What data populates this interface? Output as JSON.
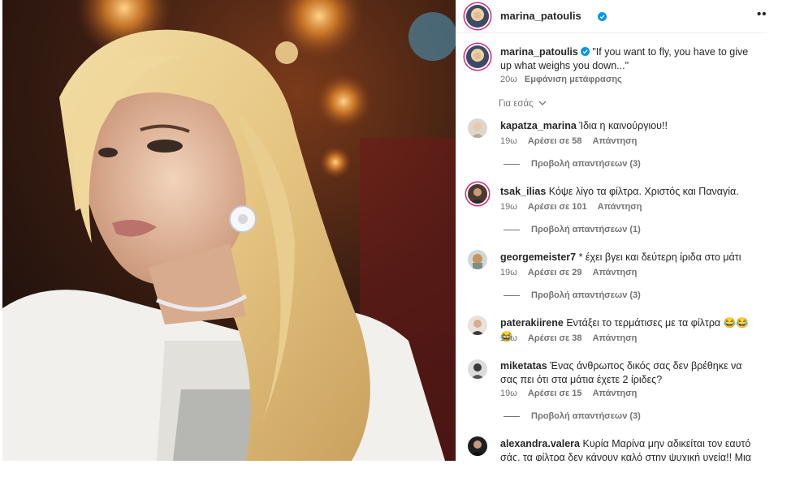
{
  "colors": {
    "accent": "#0095f6",
    "muted": "#737373",
    "text": "#262626"
  },
  "post": {
    "author": "marina_patoulis",
    "caption": "\"If you want to fly, you have to give up what weighs you down...\"",
    "age": "20ω",
    "translate_label": "Εμφάνιση μετάφρασης",
    "more_icon": "more-icon"
  },
  "sort_label": "Για εσάς",
  "comments": [
    {
      "user": "kapatza_marina",
      "text": "Ίδια η καινούργιου!!",
      "age": "19ω",
      "likes": "Αρέσει σε 58",
      "reply": "Απάντηση",
      "view_replies": "Προβολή απαντήσεων (3)"
    },
    {
      "user": "tsak_ilias",
      "text": "Κόψε λίγο τα φίλτρα. Χριστός και Παναγία.",
      "age": "19ω",
      "likes": "Αρέσει σε 101",
      "reply": "Απάντηση",
      "view_replies": "Προβολή απαντήσεων (1)"
    },
    {
      "user": "georgemeister7",
      "text": "* έχει βγει και δεύτερη ίριδα στο μάτι",
      "age": "19ω",
      "likes": "Αρέσει σε 29",
      "reply": "Απάντηση",
      "view_replies": "Προβολή απαντήσεων (3)"
    },
    {
      "user": "paterakiirene",
      "text": "Εντάξει το τερμάτισες με τα φίλτρα 😂😂😂",
      "age": "19ω",
      "likes": "Αρέσει σε 38",
      "reply": "Απάντηση",
      "view_replies": ""
    },
    {
      "user": "miketatas",
      "text": "Ένας άνθρωπος δικός σας δεν βρέθηκε να σας πει ότι στα μάτια έχετε 2 ίριδες?",
      "age": "19ω",
      "likes": "Αρέσει σε 15",
      "reply": "Απάντηση",
      "view_replies": "Προβολή απαντήσεων (3)"
    },
    {
      "user": "alexandra.valera",
      "text": "Κυρία Μαρίνα μην αδικείται τον εαυτό σάς, τα φίλτρα δεν κάνουν καλό στην ψυχική υγεία!! Μια χαρά",
      "age": "",
      "likes": "",
      "reply": "",
      "view_replies": ""
    }
  ]
}
